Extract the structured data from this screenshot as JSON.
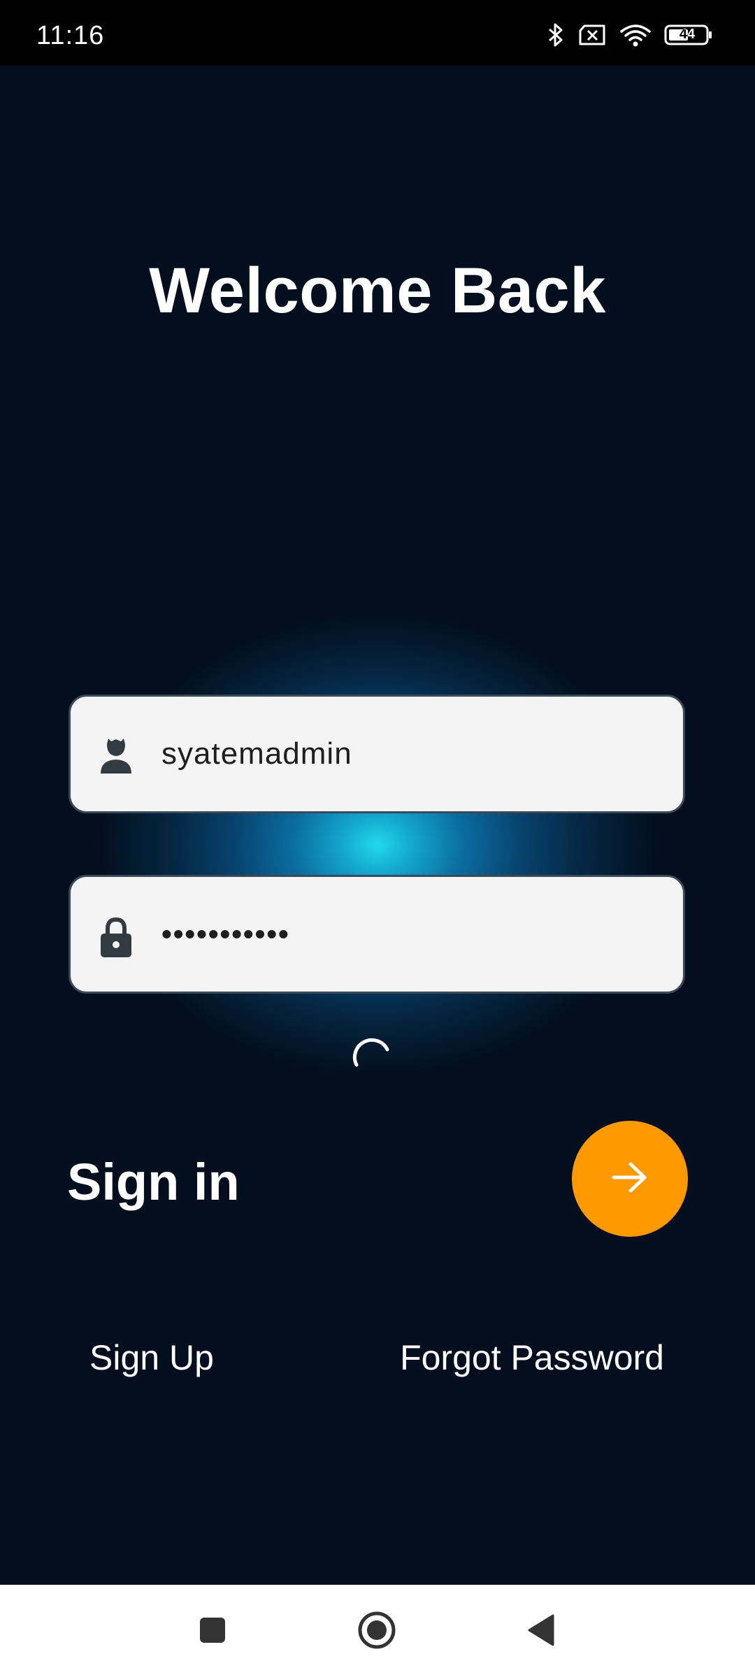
{
  "status_bar": {
    "time": "11:16",
    "battery_level": "44",
    "icons": [
      "bluetooth-icon",
      "no-sim-icon",
      "wifi-icon",
      "battery-icon"
    ]
  },
  "login": {
    "title": "Welcome Back",
    "username": {
      "value": "syatemadmin",
      "icon": "person-icon"
    },
    "password": {
      "value": "•••••••••••",
      "icon": "lock-icon"
    },
    "loading": true,
    "signin_label": "Sign in",
    "signin_button_icon": "arrow-right-icon",
    "signup_link": "Sign Up",
    "forgot_link": "Forgot Password"
  },
  "colors": {
    "accent": "#ff9900",
    "glow": "#22d9ee",
    "background": "#030e1b",
    "field_background": "#f4f4f4"
  },
  "nav_bar": {
    "buttons": [
      "recent-apps-icon",
      "home-icon",
      "back-icon"
    ]
  }
}
